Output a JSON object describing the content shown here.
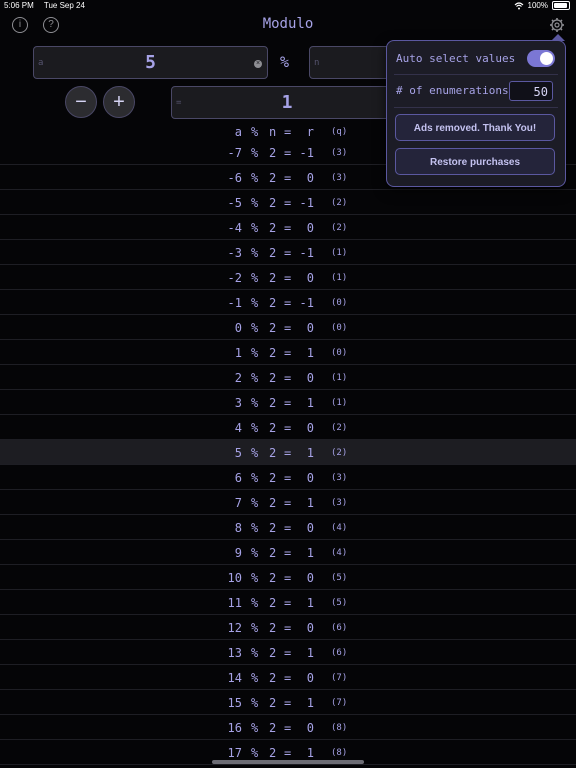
{
  "status_bar": {
    "time": "5:06 PM",
    "date": "Tue Sep 24",
    "battery": "100%"
  },
  "nav": {
    "title": "Modulo",
    "info_glyph": "i",
    "help_glyph": "?"
  },
  "inputs": {
    "a_placeholder": "a",
    "a_value": "5",
    "operator": "%",
    "n_placeholder": "n",
    "n_value": "",
    "result_placeholder": "=",
    "result_value": "1",
    "minus": "−",
    "plus": "+",
    "clear_glyph": "×"
  },
  "table": {
    "headers": {
      "a": "a",
      "op": "%",
      "n": "n",
      "eq": "=",
      "r": "r",
      "q": "(q)"
    },
    "highlight_index": 12,
    "rows": [
      {
        "a": "-7",
        "n": "2",
        "r": "-1",
        "q": "(3)"
      },
      {
        "a": "-6",
        "n": "2",
        "r": "0",
        "q": "(3)"
      },
      {
        "a": "-5",
        "n": "2",
        "r": "-1",
        "q": "(2)"
      },
      {
        "a": "-4",
        "n": "2",
        "r": "0",
        "q": "(2)"
      },
      {
        "a": "-3",
        "n": "2",
        "r": "-1",
        "q": "(1)"
      },
      {
        "a": "-2",
        "n": "2",
        "r": "0",
        "q": "(1)"
      },
      {
        "a": "-1",
        "n": "2",
        "r": "-1",
        "q": "(0)"
      },
      {
        "a": "0",
        "n": "2",
        "r": "0",
        "q": "(0)"
      },
      {
        "a": "1",
        "n": "2",
        "r": "1",
        "q": "(0)"
      },
      {
        "a": "2",
        "n": "2",
        "r": "0",
        "q": "(1)"
      },
      {
        "a": "3",
        "n": "2",
        "r": "1",
        "q": "(1)"
      },
      {
        "a": "4",
        "n": "2",
        "r": "0",
        "q": "(2)"
      },
      {
        "a": "5",
        "n": "2",
        "r": "1",
        "q": "(2)"
      },
      {
        "a": "6",
        "n": "2",
        "r": "0",
        "q": "(3)"
      },
      {
        "a": "7",
        "n": "2",
        "r": "1",
        "q": "(3)"
      },
      {
        "a": "8",
        "n": "2",
        "r": "0",
        "q": "(4)"
      },
      {
        "a": "9",
        "n": "2",
        "r": "1",
        "q": "(4)"
      },
      {
        "a": "10",
        "n": "2",
        "r": "0",
        "q": "(5)"
      },
      {
        "a": "11",
        "n": "2",
        "r": "1",
        "q": "(5)"
      },
      {
        "a": "12",
        "n": "2",
        "r": "0",
        "q": "(6)"
      },
      {
        "a": "13",
        "n": "2",
        "r": "1",
        "q": "(6)"
      },
      {
        "a": "14",
        "n": "2",
        "r": "0",
        "q": "(7)"
      },
      {
        "a": "15",
        "n": "2",
        "r": "1",
        "q": "(7)"
      },
      {
        "a": "16",
        "n": "2",
        "r": "0",
        "q": "(8)"
      },
      {
        "a": "17",
        "n": "2",
        "r": "1",
        "q": "(8)"
      }
    ]
  },
  "settings_popover": {
    "auto_select_label": "Auto select values",
    "auto_select_on": true,
    "enumerations_label": "# of enumerations",
    "enumerations_value": "50",
    "ads_button": "Ads removed. Thank You!",
    "restore_button": "Restore purchases"
  },
  "colors": {
    "accent": "#a6a2e6",
    "background": "#050507",
    "field": "#1b1b1f",
    "toggle_on": "#7b77d4"
  },
  "icons": [
    "info-icon",
    "help-icon",
    "gear-icon",
    "clear-icon",
    "wifi-icon",
    "battery-icon"
  ]
}
